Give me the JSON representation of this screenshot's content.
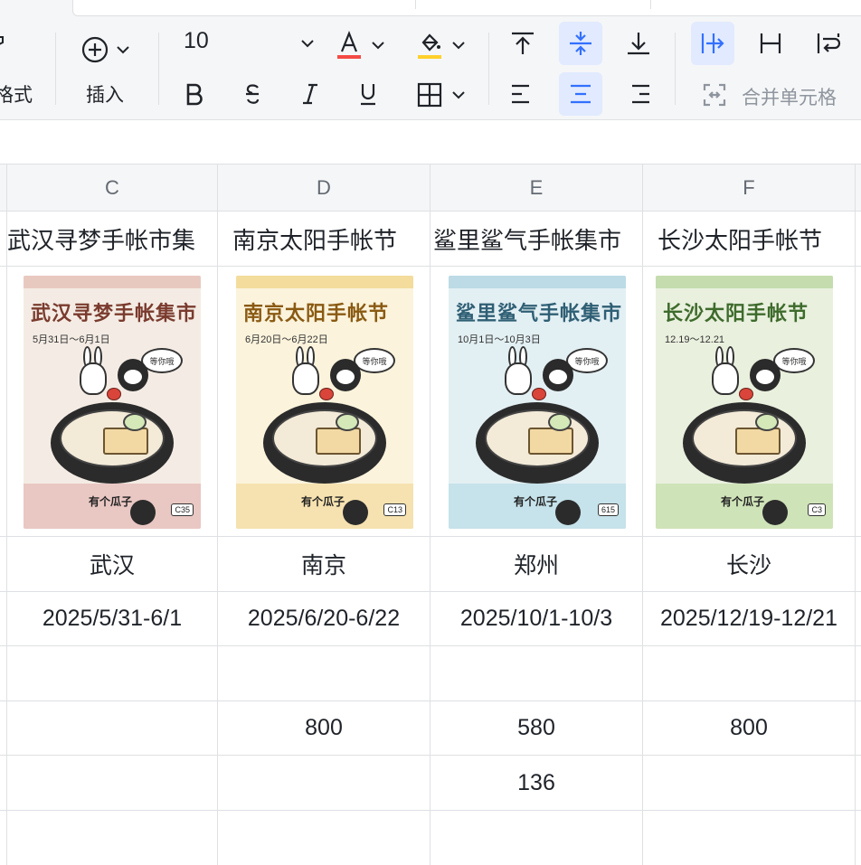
{
  "toolbar": {
    "format_label": "格式",
    "insert_label": "插入",
    "font_size": "10",
    "merge_label": "合并单元格",
    "colors": {
      "text_color_bar": "#f54a45",
      "fill_color_bar": "#ffd02b",
      "active_bg": "#e1eaff",
      "active_fg": "#3370ff"
    }
  },
  "columns": [
    "C",
    "D",
    "E",
    "F"
  ],
  "rows": {
    "titles": [
      "武汉寻梦手帐市集",
      "南京太阳手帐节",
      "鲨里鲨气手帐集市",
      "长沙太阳手帐节"
    ],
    "cities": [
      "武汉",
      "南京",
      "郑州",
      "长沙"
    ],
    "dates": [
      "2025/5/31-6/1",
      "2025/6/20-6/22",
      "2025/10/1-10/3",
      "2025/12/19-12/21"
    ],
    "values_a": [
      "",
      "800",
      "580",
      "800"
    ],
    "values_b": [
      "",
      "",
      "136",
      ""
    ]
  },
  "posters": [
    {
      "title": "武汉寻梦手帐集市",
      "date": "5月31日～6月1日",
      "bubble": "等你哦",
      "tag": "C35",
      "brand": "有个瓜子",
      "bg": "#f4ece4",
      "accent": "#7a3b2e",
      "strip": "#e8c9c0",
      "foot": "#e9c7c3"
    },
    {
      "title": "南京太阳手帐节",
      "date": "6月20日～6月22日",
      "bubble": "等你哦",
      "tag": "C13",
      "brand": "有个瓜子",
      "bg": "#fbf3dc",
      "accent": "#8a5a12",
      "strip": "#f3dc9c",
      "foot": "#f6e2b0"
    },
    {
      "title": "鲨里鲨气手帐集市",
      "date": "10月1日～10月3日",
      "bubble": "等你哦",
      "tag": "615",
      "brand": "有个瓜子",
      "bg": "#e2eff3",
      "accent": "#2f5f74",
      "strip": "#bcdbe6",
      "foot": "#c6e2ea"
    },
    {
      "title": "长沙太阳手帐节",
      "date": "12.19～12.21",
      "bubble": "等你哦",
      "tag": "C3",
      "brand": "有个瓜子",
      "bg": "#e9f0de",
      "accent": "#3e6b2c",
      "strip": "#c4dcae",
      "foot": "#cfe3b8"
    }
  ]
}
